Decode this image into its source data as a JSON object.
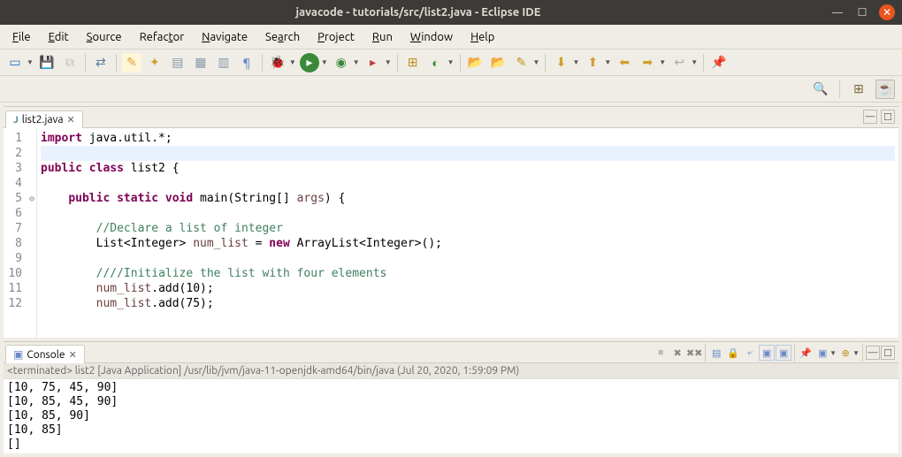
{
  "window": {
    "title": "javacode - tutorials/src/list2.java - Eclipse IDE"
  },
  "menu": {
    "file": "File",
    "edit": "Edit",
    "source": "Source",
    "refactor": "Refactor",
    "navigate": "Navigate",
    "search": "Search",
    "project": "Project",
    "run": "Run",
    "window": "Window",
    "help": "Help"
  },
  "editor": {
    "tab": "list2.java",
    "lines": [
      {
        "n": "1",
        "html": "<span class='kw'>import</span> java.util.*;"
      },
      {
        "n": "2",
        "html": "",
        "cursor": true
      },
      {
        "n": "3",
        "html": "<span class='kw'>public class</span> list2 {"
      },
      {
        "n": "4",
        "html": ""
      },
      {
        "n": "5",
        "html": "    <span class='kw'>public static void</span> main(String[] <span class='var'>args</span>) {",
        "fold": true
      },
      {
        "n": "6",
        "html": ""
      },
      {
        "n": "7",
        "html": "        <span class='cm'>//Declare a list of integer</span>"
      },
      {
        "n": "8",
        "html": "        List&lt;Integer&gt; <span class='var'>num_list</span> = <span class='kw'>new</span> ArrayList&lt;Integer&gt;();"
      },
      {
        "n": "9",
        "html": ""
      },
      {
        "n": "10",
        "html": "        <span class='cm'>////Initialize the list with four elements</span>"
      },
      {
        "n": "11",
        "html": "        <span class='var'>num_list</span>.add(10);"
      },
      {
        "n": "12",
        "html": "        <span class='var'>num_list</span>.add(75);"
      }
    ]
  },
  "console": {
    "tab": "Console",
    "header": "<terminated> list2 [Java Application] /usr/lib/jvm/java-11-openjdk-amd64/bin/java (Jul 20, 2020, 1:59:09 PM)",
    "output": "[10, 75, 45, 90]\n[10, 85, 45, 90]\n[10, 85, 90]\n[10, 85]\n[]"
  }
}
